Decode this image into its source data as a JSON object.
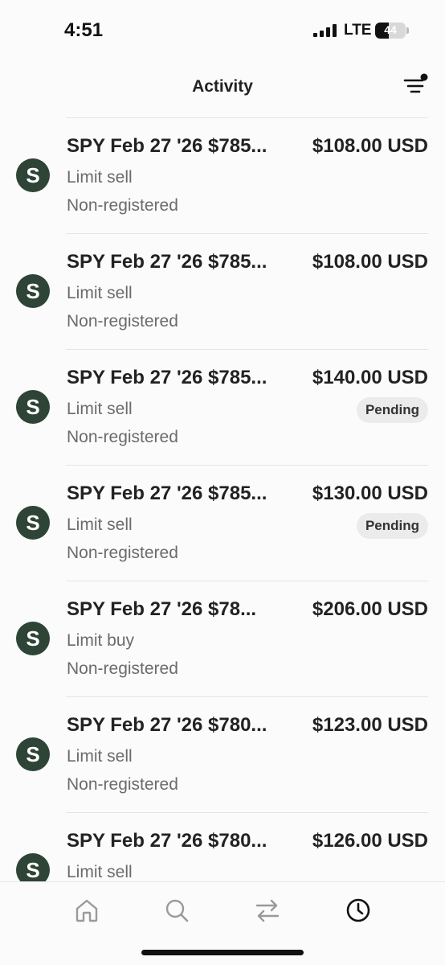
{
  "status_bar": {
    "time": "4:51",
    "network": "LTE",
    "battery": "44",
    "battery_level": 0.44
  },
  "header": {
    "title": "Activity",
    "filter_icon": "filter-icon",
    "filter_indicator": true
  },
  "colors": {
    "avatar_bg": "#2e4436",
    "badge_bg": "#ebebeb",
    "secondary_text": "#6b6b6b"
  },
  "activities": [
    {
      "avatar": "S",
      "title": "SPY Feb 27 '26 $785...",
      "amount": "$108.00 USD",
      "type": "Limit sell",
      "account": "Non-registered",
      "badge": ""
    },
    {
      "avatar": "S",
      "title": "SPY Feb 27 '26 $785...",
      "amount": "$108.00 USD",
      "type": "Limit sell",
      "account": "Non-registered",
      "badge": ""
    },
    {
      "avatar": "S",
      "title": "SPY Feb 27 '26 $785...",
      "amount": "$140.00 USD",
      "type": "Limit sell",
      "account": "Non-registered",
      "badge": "Pending"
    },
    {
      "avatar": "S",
      "title": "SPY Feb 27 '26 $785...",
      "amount": "$130.00 USD",
      "type": "Limit sell",
      "account": "Non-registered",
      "badge": "Pending"
    },
    {
      "avatar": "S",
      "title": "SPY Feb 27 '26 $78...",
      "amount": "$206.00 USD",
      "type": "Limit buy",
      "account": "Non-registered",
      "badge": ""
    },
    {
      "avatar": "S",
      "title": "SPY Feb 27 '26 $780...",
      "amount": "$123.00 USD",
      "type": "Limit sell",
      "account": "Non-registered",
      "badge": ""
    },
    {
      "avatar": "S",
      "title": "SPY Feb 27 '26 $780...",
      "amount": "$126.00 USD",
      "type": "Limit sell",
      "account": "",
      "badge": ""
    }
  ],
  "bottom_nav": [
    {
      "icon": "home-icon",
      "active": false
    },
    {
      "icon": "search-icon",
      "active": false
    },
    {
      "icon": "transfer-icon",
      "active": false
    },
    {
      "icon": "clock-icon",
      "active": true
    }
  ]
}
